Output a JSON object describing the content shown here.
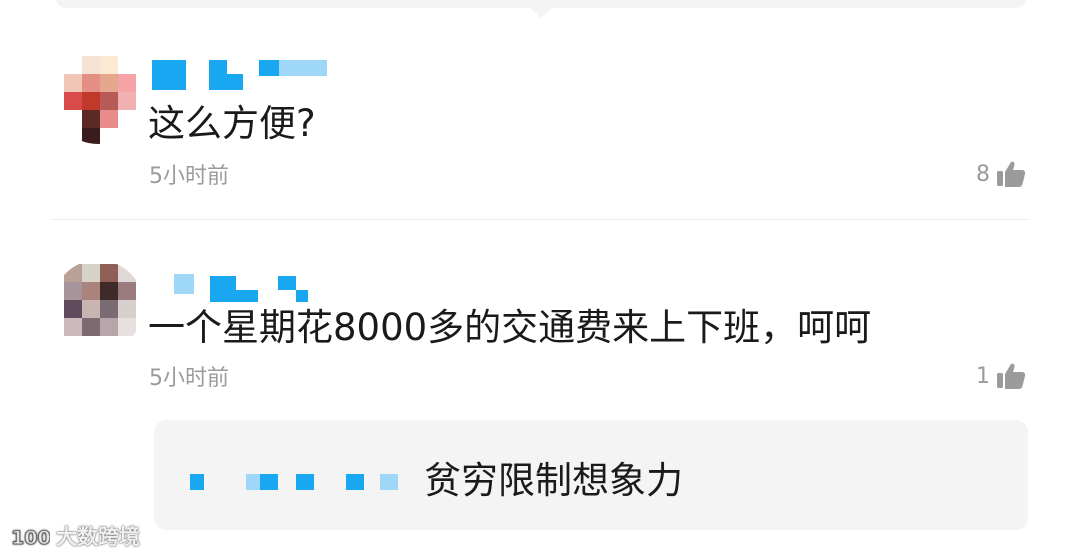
{
  "comments": [
    {
      "text": "这么方便?",
      "time": "5小时前",
      "likes": "8"
    },
    {
      "text": "一个星期花8000多的交通费来上下班，呵呵",
      "time": "5小时前",
      "likes": "1"
    }
  ],
  "reply": {
    "text": "贫穷限制想象力"
  },
  "watermark": {
    "text": "大数跨境"
  },
  "icons": {
    "like": "thumbs-up-icon",
    "watermark_logo": "brand-logo-icon"
  },
  "colors": {
    "accent_blue": "#18a7f0",
    "muted_text": "#9b9b9b",
    "card_bg": "#f4f4f5"
  }
}
